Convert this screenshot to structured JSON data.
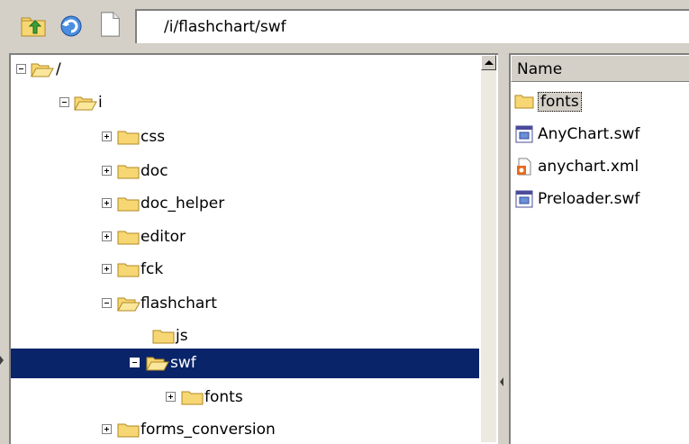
{
  "toolbar": {
    "up_icon": "folder-up-icon",
    "refresh_icon": "refresh-icon",
    "page_icon": "page-icon",
    "path": "/i/flashchart/swf"
  },
  "tree": {
    "items": [
      {
        "label": "/",
        "expanded": true
      },
      {
        "label": "i",
        "expanded": true
      },
      {
        "label": "css",
        "expanded": false
      },
      {
        "label": "doc",
        "expanded": false
      },
      {
        "label": "doc_helper",
        "expanded": false
      },
      {
        "label": "editor",
        "expanded": false
      },
      {
        "label": "fck",
        "expanded": false
      },
      {
        "label": "flashchart",
        "expanded": true
      },
      {
        "label": "js",
        "expanded": null
      },
      {
        "label": "swf",
        "expanded": true,
        "selected": true
      },
      {
        "label": "fonts",
        "expanded": false
      },
      {
        "label": "forms_conversion",
        "expanded": false
      }
    ]
  },
  "list": {
    "column_name": "Name",
    "items": [
      {
        "label": "fonts",
        "icon": "folder-icon"
      },
      {
        "label": "AnyChart.swf",
        "icon": "swf-file-icon"
      },
      {
        "label": "anychart.xml",
        "icon": "xml-file-icon"
      },
      {
        "label": "Preloader.swf",
        "icon": "swf-file-icon"
      }
    ]
  },
  "colors": {
    "selection": "#0a246a",
    "folder": "#f7d774",
    "window": "#d4d0c8"
  }
}
